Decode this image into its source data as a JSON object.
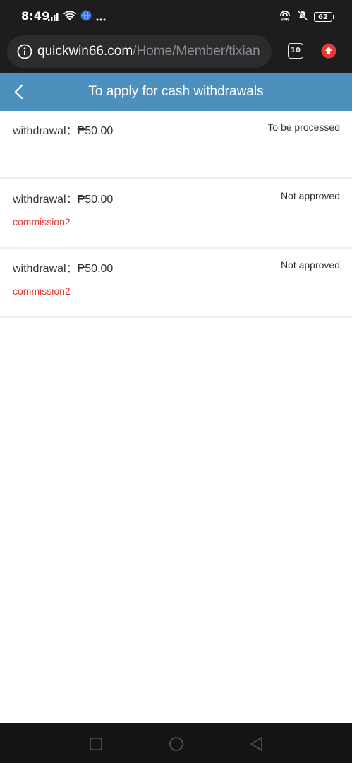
{
  "status_bar": {
    "time": "8:49",
    "battery": "62"
  },
  "browser": {
    "url_domain": "quickwin66.com",
    "url_path": "/Home/Member/tixian",
    "tab_count": "10"
  },
  "header": {
    "title": "To apply for cash withdrawals"
  },
  "records": [
    {
      "label": "withdrawal：",
      "amount": "₱50.00",
      "status": "To be processed",
      "note": ""
    },
    {
      "label": "withdrawal：",
      "amount": "₱50.00",
      "status": "Not approved",
      "note": "commission2"
    },
    {
      "label": "withdrawal：",
      "amount": "₱50.00",
      "status": "Not approved",
      "note": "commission2"
    }
  ],
  "colors": {
    "header_bg": "#4d8fbd",
    "note_red": "#e53935",
    "update_red": "#e53935"
  },
  "icons": {
    "back": "chevron-left-icon",
    "info": "info-icon",
    "update": "arrow-up-icon",
    "nav_recent": "square-icon",
    "nav_home": "circle-icon",
    "nav_back": "triangle-left-icon"
  }
}
